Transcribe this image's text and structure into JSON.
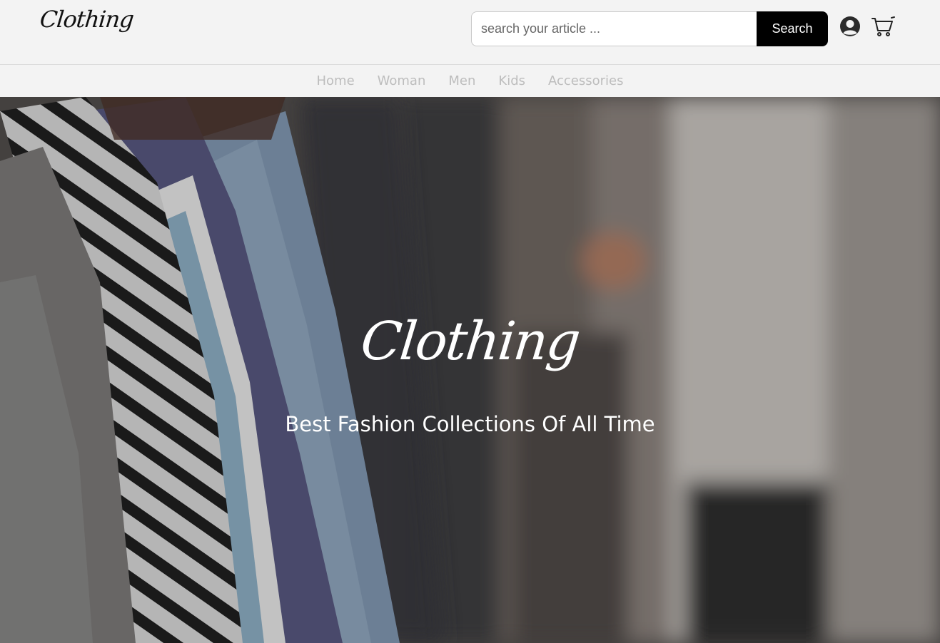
{
  "header": {
    "logo_text": "Clothing",
    "search": {
      "placeholder": "search your article ...",
      "value": "",
      "button_label": "Search"
    },
    "icons": {
      "account": "user-circle-icon",
      "cart": "shopping-cart-icon"
    }
  },
  "nav": {
    "items": [
      {
        "label": "Home"
      },
      {
        "label": "Woman"
      },
      {
        "label": "Men"
      },
      {
        "label": "Kids"
      },
      {
        "label": "Accessories"
      }
    ]
  },
  "hero": {
    "logo_text": "Clothing",
    "tagline": "Best Fashion Collections Of All Time"
  },
  "colors": {
    "accent": "#000000",
    "nav_text": "#bdbdbd",
    "header_bg": "#f3f3f3"
  }
}
